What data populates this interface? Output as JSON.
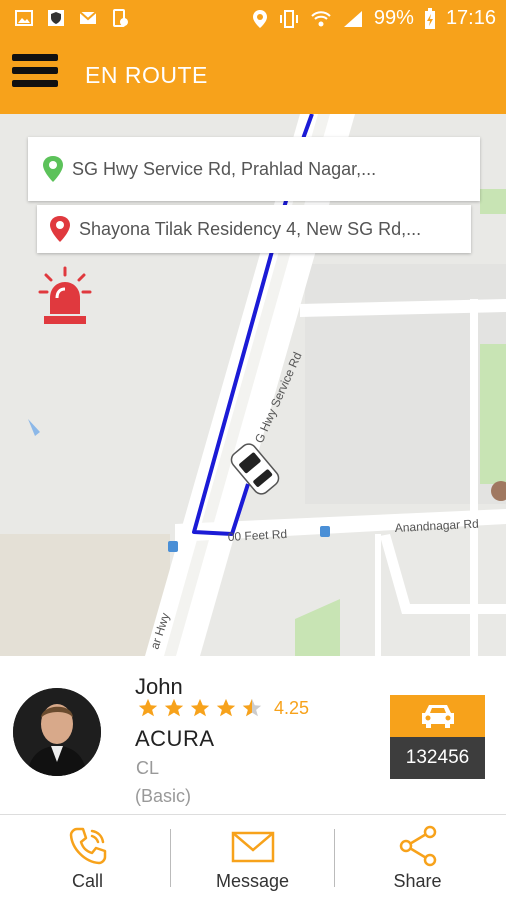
{
  "status_bar": {
    "battery": "99%",
    "time": "17:16",
    "icons": [
      "gallery-icon",
      "shield-app-icon",
      "mail-icon",
      "phone-settings-icon",
      "location-icon",
      "vibrate-icon",
      "wifi-icon",
      "signal-icon",
      "battery-icon"
    ]
  },
  "app_bar": {
    "title": "EN ROUTE",
    "menu_icon": "hamburger-icon"
  },
  "map": {
    "pickup": "SG Hwy Service Rd, Prahlad Nagar,...",
    "dropoff": "Shayona Tilak Residency 4, New SG Rd,...",
    "road_labels": [
      "G Hwy Service Rd",
      "00 Feet Rd",
      "Anandnagar Rd",
      "ar Hwy"
    ],
    "route_color": "#1b1bd6",
    "pickup_pin_color": "#5cc25a",
    "dropoff_pin_color": "#e0393e",
    "alarm_color": "#e0393e"
  },
  "driver": {
    "name": "John",
    "rating": "4.25",
    "rating_value": 4.25,
    "car_make": "ACURA",
    "car_model": "CL",
    "car_class": "(Basic)",
    "taxi_number": "132456"
  },
  "actions": [
    {
      "label": "Call",
      "icon": "phone-icon"
    },
    {
      "label": "Message",
      "icon": "envelope-icon"
    },
    {
      "label": "Share",
      "icon": "share-icon"
    }
  ],
  "colors": {
    "accent": "#f7a21b",
    "dark": "#3d3d3d"
  }
}
